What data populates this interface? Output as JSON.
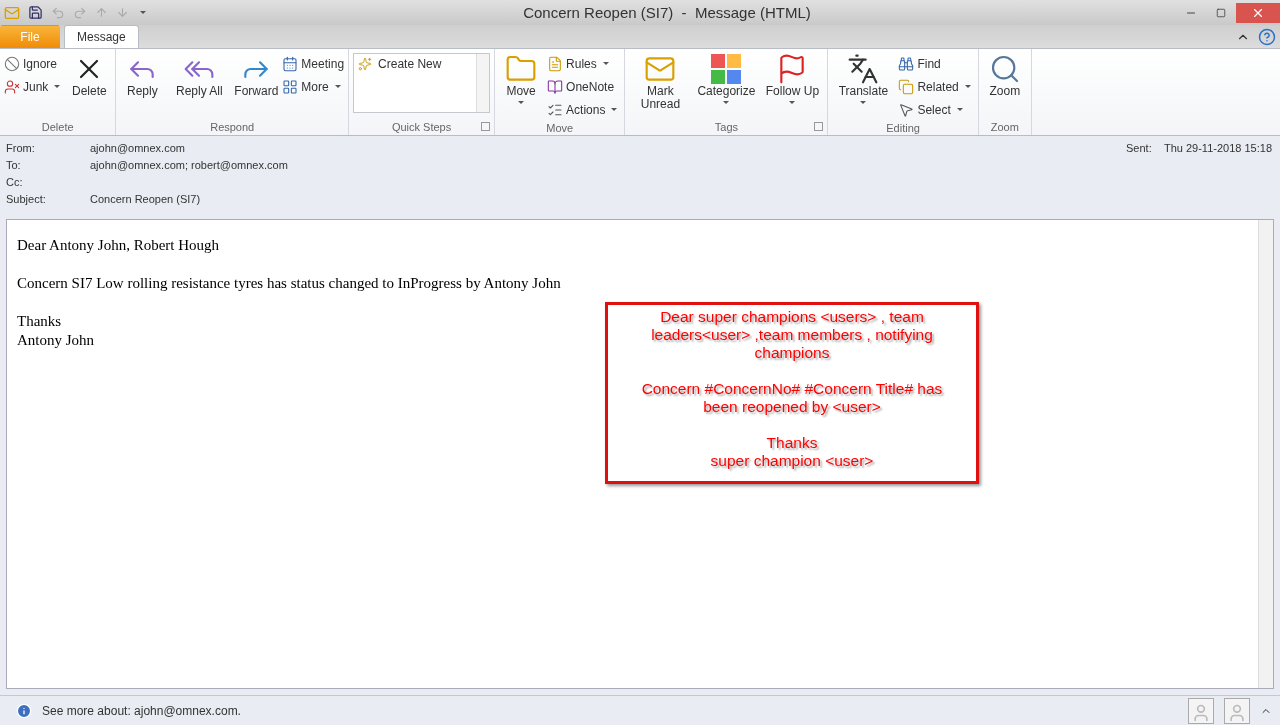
{
  "window": {
    "title": "Concern Reopen (SI7)  -  Message (HTML)"
  },
  "tabs": [
    {
      "label": "File",
      "kind": "file",
      "selected": false
    },
    {
      "label": "Message",
      "kind": "tab",
      "selected": true
    }
  ],
  "ribbon_groups": [
    {
      "name": "Delete",
      "items": [
        {
          "label": "Ignore",
          "kind": "small"
        },
        {
          "label": "Junk",
          "kind": "small",
          "dropdown": true
        },
        {
          "label": "Delete",
          "kind": "large"
        }
      ]
    },
    {
      "name": "Respond",
      "items": [
        {
          "label": "Reply",
          "kind": "large"
        },
        {
          "label": "Reply All",
          "kind": "large"
        },
        {
          "label": "Forward",
          "kind": "large"
        },
        {
          "label": "Meeting",
          "kind": "small"
        },
        {
          "label": "More",
          "kind": "small",
          "dropdown": true
        }
      ]
    },
    {
      "name": "Quick Steps",
      "launcher": true,
      "items": [
        {
          "label": "Create New",
          "kind": "gallery"
        }
      ]
    },
    {
      "name": "Move",
      "items": [
        {
          "label": "Move",
          "kind": "large",
          "dropdown": true
        },
        {
          "label": "Rules",
          "kind": "small",
          "dropdown": true
        },
        {
          "label": "OneNote",
          "kind": "small"
        },
        {
          "label": "Actions",
          "kind": "small",
          "dropdown": true
        }
      ]
    },
    {
      "name": "Tags",
      "launcher": true,
      "items": [
        {
          "label": "Mark Unread",
          "kind": "large"
        },
        {
          "label": "Categorize",
          "kind": "large",
          "dropdown": true
        },
        {
          "label": "Follow Up",
          "kind": "large",
          "dropdown": true
        }
      ]
    },
    {
      "name": "Editing",
      "items": [
        {
          "label": "Translate",
          "kind": "large",
          "dropdown": true
        },
        {
          "label": "Find",
          "kind": "small"
        },
        {
          "label": "Related",
          "kind": "small",
          "dropdown": true
        },
        {
          "label": "Select",
          "kind": "small",
          "dropdown": true
        }
      ]
    },
    {
      "name": "Zoom",
      "items": [
        {
          "label": "Zoom",
          "kind": "large"
        }
      ]
    }
  ],
  "header": {
    "fields": [
      {
        "label": "From:",
        "value": "ajohn@omnex.com"
      },
      {
        "label": "To:",
        "value": "ajohn@omnex.com; robert@omnex.com"
      },
      {
        "label": "Cc:"
      },
      {
        "label": "Subject:",
        "value": "Concern Reopen (SI7)"
      }
    ],
    "sent": {
      "label": "Sent:",
      "value": "Thu 29-11-2018 15:18"
    }
  },
  "body": {
    "paragraphs": [
      [
        "Dear Antony John, Robert Hough"
      ],
      [
        "Concern SI7 Low rolling resistance tyres has status changed to InProgress by Antony John"
      ],
      [
        "Thanks",
        "Antony John"
      ]
    ]
  },
  "annotation": {
    "paragraphs": [
      [
        "Dear super champions <users> , team leaders<user> ,team members , notifying champions"
      ],
      [
        "Concern #ConcernNo# #Concern Title# has been reopened by <user>"
      ],
      [
        "Thanks",
        "super champion <user>"
      ]
    ]
  },
  "status_bar": {
    "text": "See more about: ajohn@omnex.com."
  }
}
